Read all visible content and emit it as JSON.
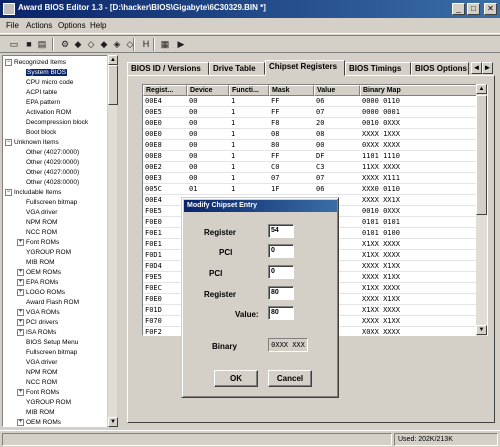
{
  "window": {
    "title": "Award BIOS Editor 1.3 - [D:\\hacker\\BIOS\\Gigabyte\\6C30329.BIN *]",
    "controls": {
      "minimize": "_",
      "maximize": "□",
      "close": "✕"
    }
  },
  "menu": [
    "File",
    "Actions",
    "Options",
    "Help"
  ],
  "toolbar": {
    "icons": [
      "open-icon",
      "save-icon",
      "save-as-icon",
      "settings-icon",
      "insert-icon",
      "extract-icon",
      "extract-all-icon",
      "replace-icon",
      "remove-icon",
      "modify-icon",
      "hex-icon",
      "checksum-icon",
      "run-icon"
    ],
    "glyphs": [
      "▭",
      "■",
      "▤",
      "⚙",
      "◆",
      "◇",
      "◆",
      "◈",
      "◇",
      "◆",
      "H",
      "▦",
      "▶"
    ]
  },
  "tree": {
    "items": [
      {
        "label": "Recognized Items",
        "level": 0,
        "expander": "−"
      },
      {
        "label": "System BIOS",
        "level": 1,
        "selected": true
      },
      {
        "label": "CPU micro code",
        "level": 1
      },
      {
        "label": "ACPI table",
        "level": 1
      },
      {
        "label": "EPA pattern",
        "level": 1
      },
      {
        "label": "Activation ROM",
        "level": 1
      },
      {
        "label": "Decompression block",
        "level": 1
      },
      {
        "label": "Boot block",
        "level": 1
      },
      {
        "label": "Unknown Items",
        "level": 0,
        "expander": "−"
      },
      {
        "label": "Other (4027:0000)",
        "level": 1
      },
      {
        "label": "Other (4029:0000)",
        "level": 1
      },
      {
        "label": "Other (4027:0000)",
        "level": 1
      },
      {
        "label": "Other (4028:0000)",
        "level": 1
      },
      {
        "label": "Includable Items",
        "level": 0,
        "expander": "−"
      },
      {
        "label": "Fullscreen bitmap",
        "level": 1
      },
      {
        "label": "VGA driver",
        "level": 1
      },
      {
        "label": "NPM ROM",
        "level": 1
      },
      {
        "label": "NCC ROM",
        "level": 1
      },
      {
        "label": "Font ROMs",
        "level": 1,
        "expander": "+"
      },
      {
        "label": "YGROUP ROM",
        "level": 1
      },
      {
        "label": "MIB ROM",
        "level": 1
      },
      {
        "label": "OEM ROMs",
        "level": 1,
        "expander": "+"
      },
      {
        "label": "EPA ROMs",
        "level": 1,
        "expander": "+"
      },
      {
        "label": "LOGO ROMs",
        "level": 1,
        "expander": "+"
      },
      {
        "label": "Award Flash ROM",
        "level": 1
      },
      {
        "label": "VGA ROMs",
        "level": 1,
        "expander": "+"
      },
      {
        "label": "PCI drivers",
        "level": 1,
        "expander": "+"
      },
      {
        "label": "ISA ROMs",
        "level": 1,
        "expander": "+"
      },
      {
        "label": "BIOS Setup Menu",
        "level": 1
      },
      {
        "label": "Fullscreen bitmap",
        "level": 1
      },
      {
        "label": "VGA driver",
        "level": 1
      },
      {
        "label": "NPM ROM",
        "level": 1
      },
      {
        "label": "NCC ROM",
        "level": 1
      },
      {
        "label": "Font ROMs",
        "level": 1,
        "expander": "+"
      },
      {
        "label": "YGROUP ROM",
        "level": 1
      },
      {
        "label": "MIB ROM",
        "level": 1
      },
      {
        "label": "OEM ROMs",
        "level": 1,
        "expander": "+"
      }
    ]
  },
  "tabs": [
    "BIOS ID / Versions",
    "Drive Table",
    "Chipset Registers",
    "BIOS Timings",
    "BIOS Options"
  ],
  "active_tab": 2,
  "table": {
    "columns": [
      "Regist...",
      "Device",
      "Functi...",
      "Mask",
      "Value",
      "Binary Map"
    ],
    "rows": [
      [
        "00E4",
        "00",
        "1",
        "FF",
        "06",
        "0000 0110"
      ],
      [
        "00E5",
        "00",
        "1",
        "FF",
        "07",
        "0000 0001"
      ],
      [
        "00E0",
        "00",
        "1",
        "F8",
        "20",
        "0010 0XXX"
      ],
      [
        "00E0",
        "00",
        "1",
        "08",
        "08",
        "XXXX 1XXX"
      ],
      [
        "00E8",
        "00",
        "1",
        "80",
        "00",
        "0XXX XXXX"
      ],
      [
        "00E8",
        "00",
        "1",
        "FF",
        "DF",
        "1101 1110"
      ],
      [
        "00E2",
        "00",
        "1",
        "C0",
        "C3",
        "11XX XXXX"
      ],
      [
        "00E3",
        "00",
        "1",
        "07",
        "07",
        "XXXX X111"
      ],
      [
        "005C",
        "01",
        "1",
        "1F",
        "06",
        "XXX0 0110"
      ],
      [
        "00E4",
        "",
        "",
        "",
        "",
        "XXXX XX1X"
      ],
      [
        "F0E5",
        "",
        "",
        "",
        "",
        "0010 0XXX"
      ],
      [
        "F0E0",
        "",
        "",
        "",
        "",
        "0101 0101"
      ],
      [
        "F0E1",
        "",
        "",
        "",
        "",
        "0101 0100"
      ],
      [
        "F0E1",
        "",
        "",
        "",
        "",
        "X1XX XXXX"
      ],
      [
        "F0D1",
        "",
        "",
        "",
        "",
        "X1XX XXXX"
      ],
      [
        "F0D4",
        "",
        "",
        "",
        "",
        "XXXX X1XX"
      ],
      [
        "F9E5",
        "",
        "",
        "",
        "",
        "XXXX X1XX"
      ],
      [
        "F0EC",
        "",
        "",
        "",
        "",
        "X1XX XXXX"
      ],
      [
        "F0E0",
        "",
        "",
        "",
        "",
        "XXXX X1XX"
      ],
      [
        "F01D",
        "",
        "",
        "",
        "",
        "X1XX XXXX"
      ],
      [
        "F070",
        "",
        "",
        "",
        "",
        "XXXX X1XX"
      ],
      [
        "F0F2",
        "",
        "",
        "",
        "",
        "X0XX XXXX"
      ]
    ]
  },
  "dialog": {
    "title": "Modify Chipset Entry",
    "fields": [
      {
        "label": "Register",
        "value": "54"
      },
      {
        "label": "PCI",
        "value": "0"
      },
      {
        "label": "PCI",
        "value": "0"
      },
      {
        "label": "Register",
        "value": "80"
      },
      {
        "label": "Value:",
        "value": "80"
      }
    ],
    "binary_label": "Binary",
    "binary_value": "0XXX XXX",
    "ok_label": "OK",
    "cancel_label": "Cancel"
  },
  "status": {
    "left": "",
    "right": "Used: 202K/213K"
  },
  "colors": {
    "titlebar_start": "#0a246a",
    "titlebar_end": "#3a6ea5",
    "face": "#d4d0c8",
    "selection": "#0a246a"
  }
}
